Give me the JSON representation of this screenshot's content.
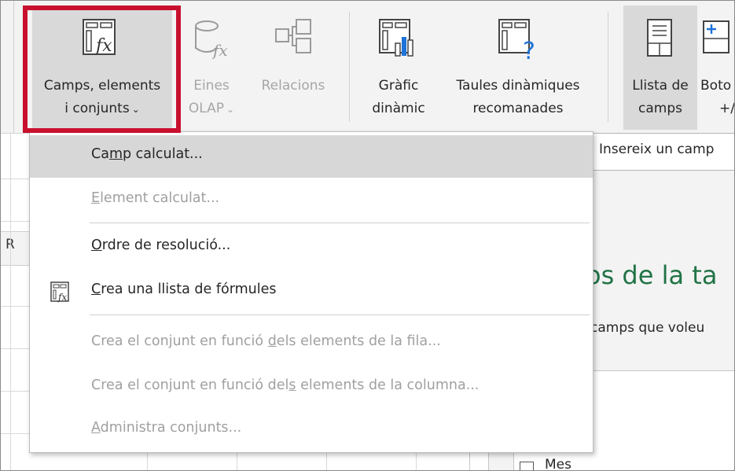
{
  "ribbon": {
    "fields_button": {
      "line1": "Camps, elements",
      "line2": "i conjunts",
      "chevron": "⌄"
    },
    "olap_button": {
      "line1": "Eines",
      "line2": "OLAP",
      "chevron": "⌄"
    },
    "relations_button": {
      "line1": "Relacions",
      "line2": ""
    },
    "pivotchart_button": {
      "line1": "Gràfic",
      "line2": "dinàmic"
    },
    "recommended_button": {
      "line1": "Taules dinàmiques",
      "line2": "recomanades"
    },
    "fieldlist_button": {
      "line1": "Llista de",
      "line2": "camps"
    },
    "buttons_button": {
      "line1": "Boto",
      "line2": "+/"
    }
  },
  "menu": {
    "items": [
      {
        "pre": "Ca",
        "ul": "m",
        "post": "p calculat...",
        "enabled": true
      },
      {
        "pre": "",
        "ul": "E",
        "post": "lement calculat...",
        "enabled": false
      },
      {
        "pre": "",
        "ul": "O",
        "post": "rdre de resolució...",
        "enabled": true
      },
      {
        "pre": "",
        "ul": "C",
        "post": "rea una llista de fórmules",
        "enabled": true
      },
      {
        "pre": "Crea el conjunt en funció ",
        "ul": "d",
        "post": "els elements de la fila...",
        "enabled": false
      },
      {
        "pre": "Crea el conjunt en funció del",
        "ul": "s",
        "post": " elements de la columna...",
        "enabled": false
      },
      {
        "pre": "",
        "ul": "A",
        "post": "dministra conjunts...",
        "enabled": false
      }
    ]
  },
  "tooltip": {
    "text": "Insereix un camp"
  },
  "sheet": {
    "column_letter": "R"
  },
  "pane": {
    "title": "os de la ta",
    "subtitle": "camps que voleu",
    "field_item": "Mes"
  },
  "colors": {
    "highlight": "#c8102e",
    "accent_green": "#217346",
    "blue_icon": "#1e73d8"
  }
}
